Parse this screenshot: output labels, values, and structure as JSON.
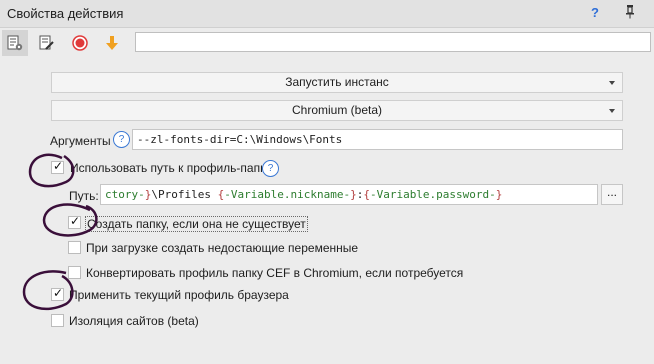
{
  "window": {
    "title": "Свойства действия",
    "help_symbol": "?"
  },
  "toolbar": {
    "icons": [
      "properties-icon",
      "edit-icon",
      "record-icon",
      "download-arrow-icon"
    ],
    "input_value": ""
  },
  "action_dropdown": {
    "value": "Запустить инстанс"
  },
  "browser_dropdown": {
    "value": "Chromium (beta)"
  },
  "arguments": {
    "label": "Аргументы",
    "help": "?",
    "value": "--zl-fonts-dir=C:\\Windows\\Fonts"
  },
  "use_profile_path": {
    "label": "Использовать путь к профиль-папке",
    "checked": true,
    "help": "?"
  },
  "path": {
    "label": "Путь:",
    "segments": [
      {
        "text": "ctory-",
        "style": "var"
      },
      {
        "text": "}",
        "style": "brace"
      },
      {
        "text": "\\Profiles ",
        "style": "plain"
      },
      {
        "text": "{",
        "style": "brace"
      },
      {
        "text": "-Variable.nickname-",
        "style": "var"
      },
      {
        "text": "}",
        "style": "brace"
      },
      {
        "text": ":",
        "style": "plain"
      },
      {
        "text": "{",
        "style": "brace"
      },
      {
        "text": "-Variable.password-",
        "style": "var"
      },
      {
        "text": "}",
        "style": "brace"
      }
    ],
    "browse_label": "..."
  },
  "options": [
    {
      "label": "Создать папку, если она не существует",
      "checked": true
    },
    {
      "label": "При загрузке создать недостающие переменные",
      "checked": false
    },
    {
      "label": "Конвертировать профиль папку CEF в Chromium, если потребуется",
      "checked": false
    }
  ],
  "apply_profile": {
    "label": "Применить текущий профиль браузера",
    "checked": true
  },
  "site_isolation": {
    "label": "Изоляция сайтов (beta)",
    "checked": false
  },
  "colors": {
    "accent": "#2f6fd8",
    "record": "#e03a3a",
    "download": "#f0a020",
    "scribble": "#3a0f3a"
  }
}
